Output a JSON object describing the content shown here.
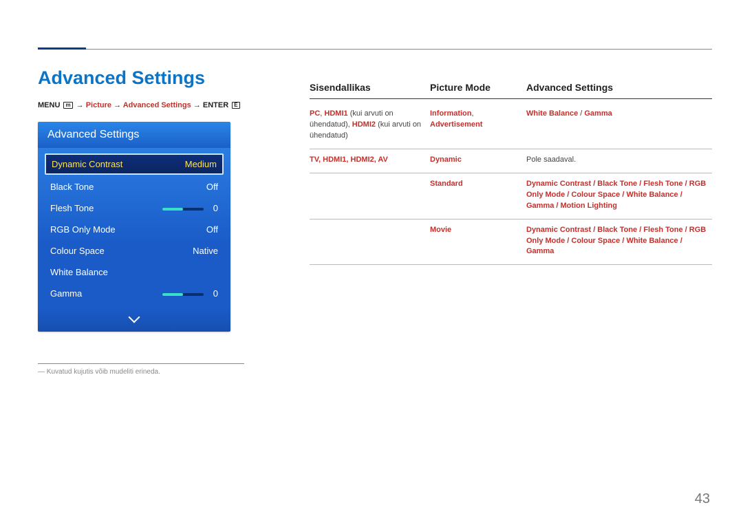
{
  "pageTitle": "Advanced Settings",
  "pageNumber": "43",
  "breadcrumb": {
    "menu": "MENU",
    "arrow": " → ",
    "picture": "Picture",
    "adv": "Advanced Settings",
    "enter": "ENTER"
  },
  "osd": {
    "header": "Advanced Settings",
    "rows": [
      {
        "label": "Dynamic Contrast",
        "value": "Medium",
        "selected": true
      },
      {
        "label": "Black Tone",
        "value": "Off"
      },
      {
        "label": "Flesh Tone",
        "value": "0",
        "slider": true
      },
      {
        "label": "RGB Only Mode",
        "value": "Off"
      },
      {
        "label": "Colour Space",
        "value": "Native"
      },
      {
        "label": "White Balance",
        "value": ""
      },
      {
        "label": "Gamma",
        "value": "0",
        "slider": true
      }
    ]
  },
  "footnote": "Kuvatud kujutis võib mudeliti erineda.",
  "footnotePrefix": "―",
  "table": {
    "headers": {
      "src": "Sisendallikas",
      "pm": "Picture Mode",
      "adv": "Advanced Settings"
    },
    "row1": {
      "src_pc": "PC",
      "src_hdmi1": "HDMI1",
      "src_mid": " (kui arvuti on ühendatud), ",
      "src_hdmi2": "HDMI2",
      "src_end": " (kui arvuti on ühendatud)",
      "pm_info": "Information",
      "pm_sep": ", ",
      "pm_ad": "Advertisement",
      "adv_wb": "White Balance",
      "adv_sep": " / ",
      "adv_gamma": "Gamma"
    },
    "row2": {
      "src": "TV, HDMI1, HDMI2, AV",
      "sub": [
        {
          "pm": "Dynamic",
          "adv_plain": "Pole saadaval."
        },
        {
          "pm": "Standard",
          "adv": "Dynamic Contrast / Black Tone / Flesh Tone / RGB Only Mode / Colour Space / White Balance / Gamma / Motion Lighting"
        },
        {
          "pm": "Movie",
          "adv": "Dynamic Contrast / Black Tone / Flesh Tone / RGB Only Mode / Colour Space / White Balance / Gamma"
        }
      ]
    }
  }
}
